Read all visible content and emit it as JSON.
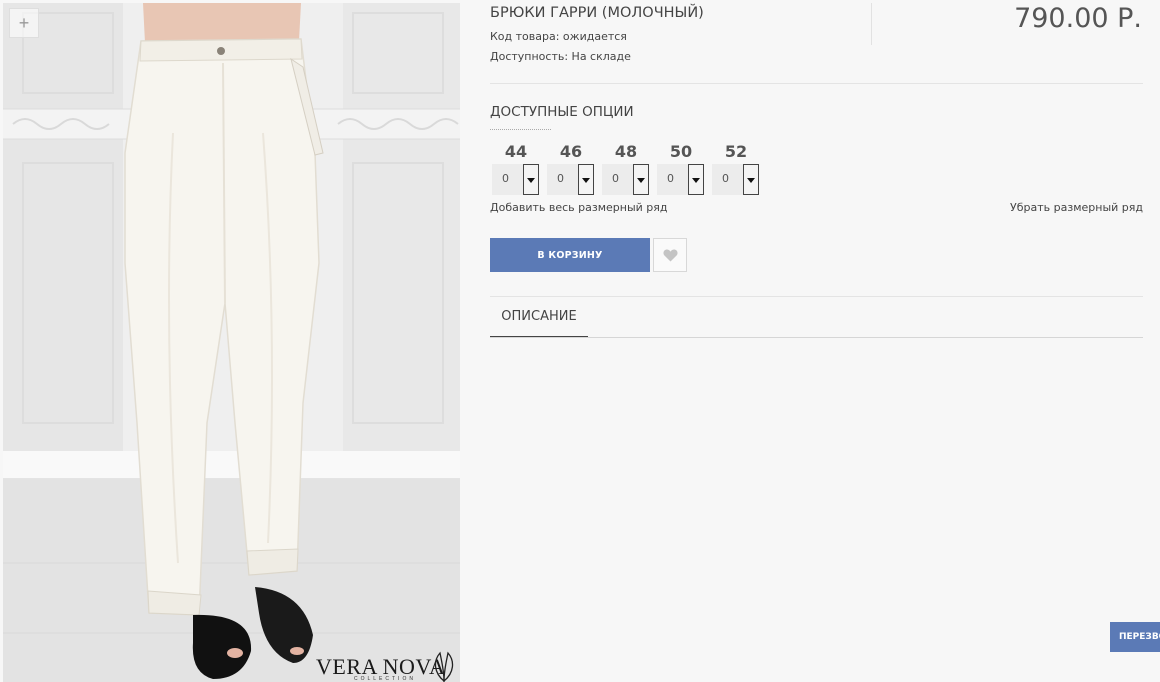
{
  "product": {
    "title": "БРЮКИ ГАРРИ (МОЛОЧНЫЙ)",
    "code_line": "Код товара: ожидается",
    "availability_line": "Доступность: На складе",
    "price": "790.00 Р."
  },
  "image": {
    "zoom_label": "+",
    "zoom_icon": "plus-icon",
    "brand_name": "VERA NOVA",
    "brand_sub": "COLLECTION"
  },
  "options": {
    "heading": "ДОСТУПНЫЕ ОПЦИИ",
    "sizes": [
      {
        "label": "44",
        "value": "0"
      },
      {
        "label": "46",
        "value": "0"
      },
      {
        "label": "48",
        "value": "0"
      },
      {
        "label": "50",
        "value": "0"
      },
      {
        "label": "52",
        "value": "0"
      }
    ],
    "add_row": "Добавить весь размерный ряд",
    "remove_row": "Убрать размерный ряд"
  },
  "actions": {
    "cart_label": "В КОРЗИНУ",
    "wishlist_icon": "heart-icon"
  },
  "tabs": {
    "description": "ОПИСАНИЕ"
  },
  "callback": {
    "label": "ПЕРЕЗВО"
  },
  "colors": {
    "accent": "#5b7ab6",
    "background": "#f7f7f7"
  }
}
